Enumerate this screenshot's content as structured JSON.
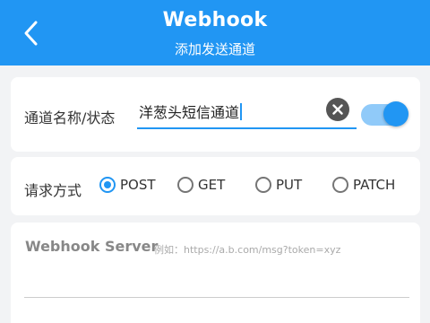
{
  "header": {
    "title": "Webhook",
    "subtitle": "添加发送通道",
    "color": "#2196f3"
  },
  "channel": {
    "label": "通道名称/状态",
    "name_value": "洋葱头短信通道",
    "enabled": true
  },
  "method": {
    "label": "请求方式",
    "options": [
      "POST",
      "GET",
      "PUT",
      "PATCH"
    ],
    "selected": "POST"
  },
  "server": {
    "label": "Webhook Server",
    "placeholder": "例如：https://a.b.com/msg?token=xyz"
  }
}
